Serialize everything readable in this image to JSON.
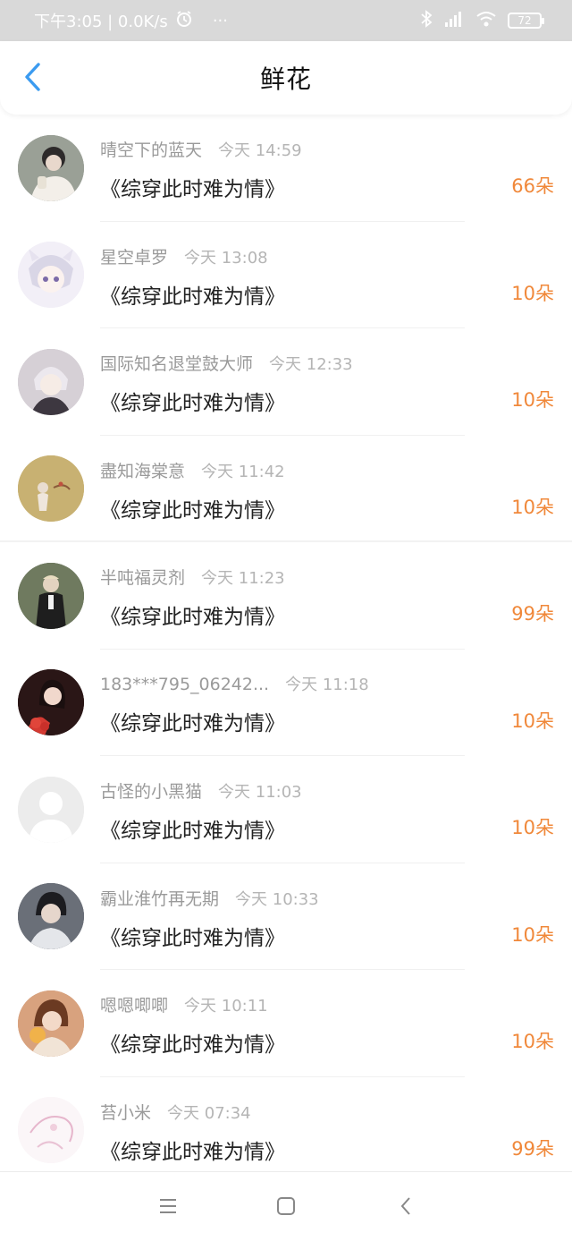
{
  "status_bar": {
    "time_and_speed": "下午3:05 | 0.0K/s",
    "more": "···",
    "battery": "72"
  },
  "header": {
    "title": "鲜花"
  },
  "entries": [
    {
      "user": "晴空下的蓝天",
      "time": "今天 14:59",
      "book": "《综穿此时难为情》",
      "count": "66朵",
      "avatar_color": "#8a8f88"
    },
    {
      "user": "星空卓罗",
      "time": "今天 13:08",
      "book": "《综穿此时难为情》",
      "count": "10朵",
      "avatar_color": "#c9c3dc"
    },
    {
      "user": "国际知名退堂鼓大师",
      "time": "今天 12:33",
      "book": "《综穿此时难为情》",
      "count": "10朵",
      "avatar_color": "#b8b0b8"
    },
    {
      "user": "盡知海棠意",
      "time": "今天 11:42",
      "book": "《综穿此时难为情》",
      "count": "10朵",
      "avatar_color": "#c4ad6c"
    },
    {
      "user": "半吨福灵剂",
      "time": "今天 11:23",
      "book": "《综穿此时难为情》",
      "count": "99朵",
      "avatar_color": "#4e5a45"
    },
    {
      "user": "183***795_06242...",
      "time": "今天 11:18",
      "book": "《综穿此时难为情》",
      "count": "10朵",
      "avatar_color": "#5a2a28"
    },
    {
      "user": "古怪的小黑猫",
      "time": "今天 11:03",
      "book": "《综穿此时难为情》",
      "count": "10朵",
      "avatar_color": "#ececec"
    },
    {
      "user": "霸业淮竹再无期",
      "time": "今天 10:33",
      "book": "《综穿此时难为情》",
      "count": "10朵",
      "avatar_color": "#4b4f58"
    },
    {
      "user": "嗯嗯唧唧",
      "time": "今天 10:11",
      "book": "《综穿此时难为情》",
      "count": "10朵",
      "avatar_color": "#c98f6e"
    },
    {
      "user": "苔小米",
      "time": "今天 07:34",
      "book": "《综穿此时难为情》",
      "count": "99朵",
      "avatar_color": "#f3e3ec"
    }
  ],
  "icons": {
    "back": "chevron-left-icon",
    "menu": "menu-icon",
    "home": "home-square-icon",
    "nav_back": "nav-back-icon"
  },
  "colors": {
    "accent_blue": "#3b9bf0",
    "flower_count": "#f0883a"
  }
}
